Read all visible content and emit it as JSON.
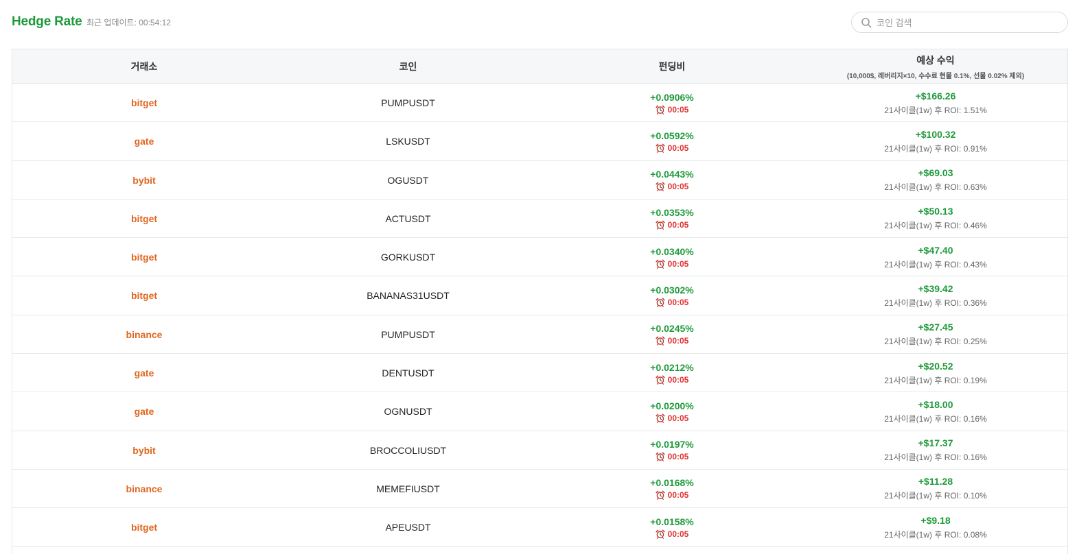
{
  "header": {
    "brand": "Hedge Rate",
    "updated_label": "최근 업데이트: 00:54:12"
  },
  "search": {
    "placeholder": "코인 검색",
    "value": ""
  },
  "colors": {
    "brand": "#1e9a3a",
    "exchange": "#e0661f",
    "positive": "#1e9a3a",
    "timer": "#e03131"
  },
  "table": {
    "headers": {
      "exchange": "거래소",
      "coin": "코인",
      "funding": "펀딩비",
      "profit": "예상 수익",
      "profit_sub": "(10,000$, 레버리지×10, 수수료 현물 0.1%, 선물 0.02% 제외)"
    },
    "rows": [
      {
        "exchange": "bitget",
        "coin": "PUMPUSDT",
        "rate": "+0.0906%",
        "timer": "00:05",
        "profit": "+$166.26",
        "roi": "21사이클(1w) 후 ROI: 1.51%"
      },
      {
        "exchange": "gate",
        "coin": "LSKUSDT",
        "rate": "+0.0592%",
        "timer": "00:05",
        "profit": "+$100.32",
        "roi": "21사이클(1w) 후 ROI: 0.91%"
      },
      {
        "exchange": "bybit",
        "coin": "OGUSDT",
        "rate": "+0.0443%",
        "timer": "00:05",
        "profit": "+$69.03",
        "roi": "21사이클(1w) 후 ROI: 0.63%"
      },
      {
        "exchange": "bitget",
        "coin": "ACTUSDT",
        "rate": "+0.0353%",
        "timer": "00:05",
        "profit": "+$50.13",
        "roi": "21사이클(1w) 후 ROI: 0.46%"
      },
      {
        "exchange": "bitget",
        "coin": "GORKUSDT",
        "rate": "+0.0340%",
        "timer": "00:05",
        "profit": "+$47.40",
        "roi": "21사이클(1w) 후 ROI: 0.43%"
      },
      {
        "exchange": "bitget",
        "coin": "BANANAS31USDT",
        "rate": "+0.0302%",
        "timer": "00:05",
        "profit": "+$39.42",
        "roi": "21사이클(1w) 후 ROI: 0.36%"
      },
      {
        "exchange": "binance",
        "coin": "PUMPUSDT",
        "rate": "+0.0245%",
        "timer": "00:05",
        "profit": "+$27.45",
        "roi": "21사이클(1w) 후 ROI: 0.25%"
      },
      {
        "exchange": "gate",
        "coin": "DENTUSDT",
        "rate": "+0.0212%",
        "timer": "00:05",
        "profit": "+$20.52",
        "roi": "21사이클(1w) 후 ROI: 0.19%"
      },
      {
        "exchange": "gate",
        "coin": "OGNUSDT",
        "rate": "+0.0200%",
        "timer": "00:05",
        "profit": "+$18.00",
        "roi": "21사이클(1w) 후 ROI: 0.16%"
      },
      {
        "exchange": "bybit",
        "coin": "BROCCOLIUSDT",
        "rate": "+0.0197%",
        "timer": "00:05",
        "profit": "+$17.37",
        "roi": "21사이클(1w) 후 ROI: 0.16%"
      },
      {
        "exchange": "binance",
        "coin": "MEMEFIUSDT",
        "rate": "+0.0168%",
        "timer": "00:05",
        "profit": "+$11.28",
        "roi": "21사이클(1w) 후 ROI: 0.10%"
      },
      {
        "exchange": "bitget",
        "coin": "APEUSDT",
        "rate": "+0.0158%",
        "timer": "00:05",
        "profit": "+$9.18",
        "roi": "21사이클(1w) 후 ROI: 0.08%"
      }
    ]
  }
}
